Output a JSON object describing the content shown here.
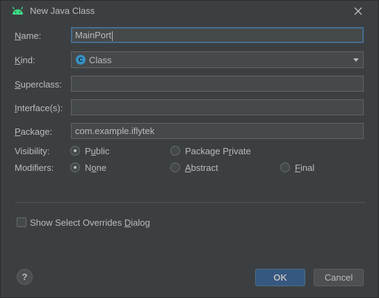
{
  "window": {
    "title": "New Java Class",
    "icon": "android-icon",
    "close_icon": "close-icon"
  },
  "form": {
    "name": {
      "label_pre": "",
      "label_mn": "N",
      "label_post": "ame:",
      "value": "MainPort"
    },
    "kind": {
      "label_pre": "",
      "label_mn": "K",
      "label_post": "ind:",
      "value": "Class",
      "icon_letter": "C",
      "icon": "class-icon"
    },
    "superclass": {
      "label_pre": "",
      "label_mn": "S",
      "label_post": "uperclass:",
      "value": ""
    },
    "interfaces": {
      "label_pre": "",
      "label_mn": "I",
      "label_post": "nterface(s):",
      "value": ""
    },
    "package": {
      "label_pre": "",
      "label_mn": "P",
      "label_post": "ackage:",
      "value": "com.example.iflytek"
    },
    "visibility": {
      "label": "Visibility:",
      "options": [
        {
          "pre": "P",
          "mn": "u",
          "post": "blic",
          "checked": true
        },
        {
          "pre": "Package P",
          "mn": "r",
          "post": "ivate",
          "checked": false
        }
      ]
    },
    "modifiers": {
      "label": "Modifiers:",
      "options": [
        {
          "pre": "N",
          "mn": "o",
          "post": "ne",
          "checked": true
        },
        {
          "pre": "",
          "mn": "A",
          "post": "bstract",
          "checked": false
        },
        {
          "pre": "",
          "mn": "F",
          "post": "inal",
          "checked": false
        }
      ]
    }
  },
  "overrides_dialog": {
    "pre": "Show Select Overrides ",
    "mn": "D",
    "post": "ialog",
    "checked": false
  },
  "buttons": {
    "help": "?",
    "ok": "OK",
    "cancel": "Cancel"
  },
  "colors": {
    "background": "#3c3f41",
    "accent": "#365880",
    "focus": "#466d94",
    "class_icon": "#3592c4",
    "android": "#3ddc84"
  }
}
